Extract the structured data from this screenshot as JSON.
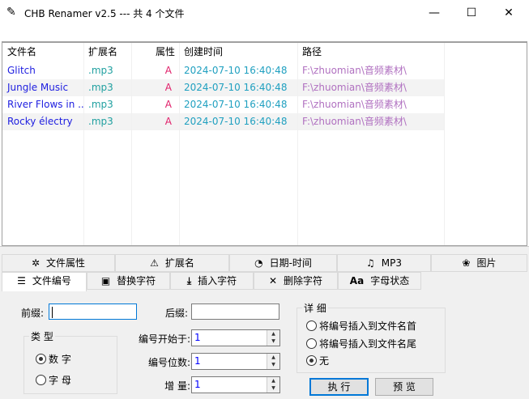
{
  "window": {
    "title": "CHB Renamer v2.5 --- 共 4 个文件",
    "minimize": "—",
    "maximize": "☐",
    "close": "✕"
  },
  "list": {
    "columns": [
      "文件名",
      "扩展名",
      "属性",
      "创建时间",
      "路径"
    ],
    "rows": [
      [
        "Glitch",
        ".mp3",
        "A",
        "2024-07-10 16:40:48",
        "F:\\zhuomian\\音频素材\\"
      ],
      [
        "Jungle Music",
        ".mp3",
        "A",
        "2024-07-10 16:40:48",
        "F:\\zhuomian\\音频素材\\"
      ],
      [
        "River Flows in ...",
        ".mp3",
        "A",
        "2024-07-10 16:40:48",
        "F:\\zhuomian\\音频素材\\"
      ],
      [
        "Rocky électry",
        ".mp3",
        "A",
        "2024-07-10 16:40:48",
        "F:\\zhuomian\\音频素材\\"
      ]
    ]
  },
  "tabs_row1": [
    {
      "label": "文件属性",
      "icon": "✲"
    },
    {
      "label": "扩展名",
      "icon": "⚠"
    },
    {
      "label": "日期-时间",
      "icon": "◔"
    },
    {
      "label": "MP3",
      "icon": "♫"
    },
    {
      "label": "图片",
      "icon": "❀"
    }
  ],
  "tabs_row2": [
    {
      "label": "文件编号",
      "icon": "☰"
    },
    {
      "label": "替换字符",
      "icon": "▣"
    },
    {
      "label": "插入字符",
      "icon": "⤓"
    },
    {
      "label": "删除字符",
      "icon": "✕"
    },
    {
      "label": "字母状态",
      "icon": "Aa"
    }
  ],
  "form": {
    "prefix_label": "前缀:",
    "prefix_value": "",
    "suffix_label": "后缀:",
    "suffix_value": "",
    "type_group": "类 型",
    "type_options": [
      "数 字",
      "字 母"
    ],
    "start_label": "编号开始于:",
    "start_value": "1",
    "digits_label": "编号位数:",
    "digits_value": "1",
    "step_label": "增 量:",
    "step_value": "1",
    "detail_group": "详 细",
    "detail_options": [
      "将编号插入到文件名首",
      "将编号插入到文件名尾",
      "无"
    ],
    "execute": "执 行",
    "preview": "预 览"
  },
  "colors": {
    "name": "#2020e0",
    "ext": "#20a0a0",
    "attr": "#e0206a",
    "date": "#20a0c0",
    "path": "#b070c0"
  }
}
